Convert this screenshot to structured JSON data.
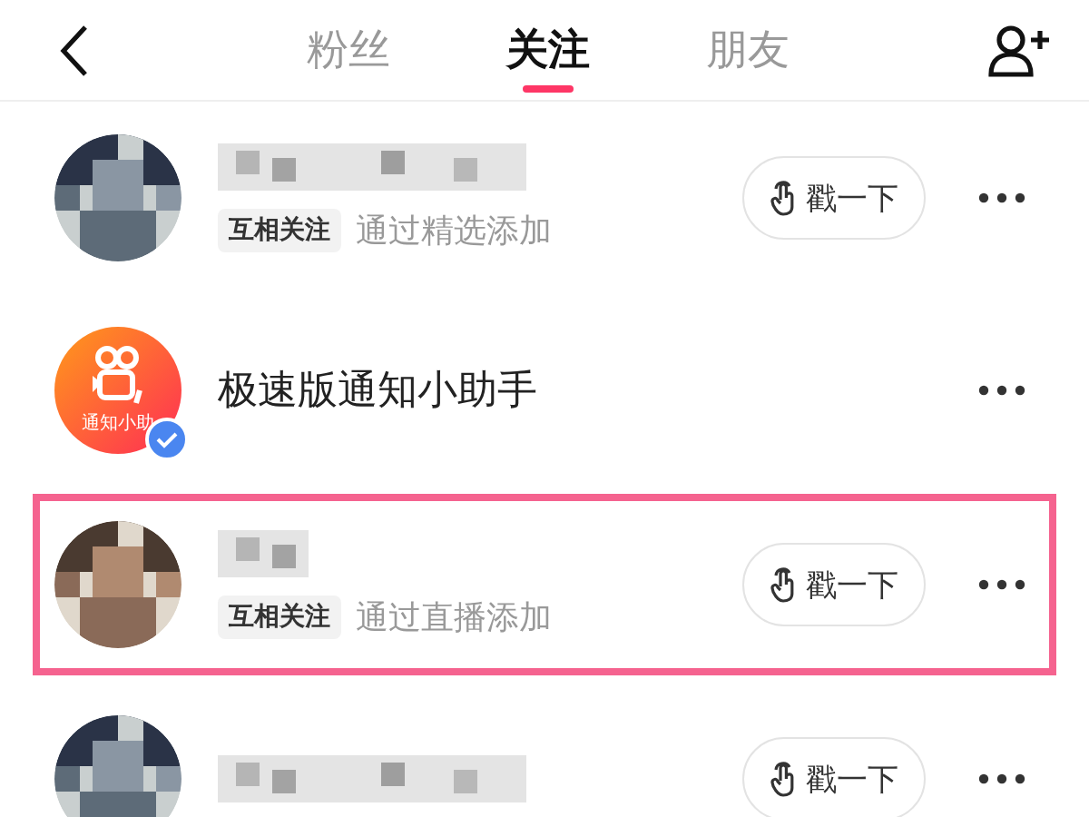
{
  "tabs": [
    {
      "label": "粉丝",
      "selected": false
    },
    {
      "label": "关注",
      "selected": true
    },
    {
      "label": "朋友",
      "selected": false
    }
  ],
  "rows": [
    {
      "kind": "person",
      "highlighted": false,
      "tag": "互相关注",
      "source": "通过精选添加",
      "action": "戳一下"
    },
    {
      "kind": "official",
      "highlighted": false,
      "name": "极速版通知小助手",
      "avatar_caption": "通知小助",
      "verified": true
    },
    {
      "kind": "person",
      "highlighted": true,
      "tag": "互相关注",
      "source": "通过直播添加",
      "action": "戳一下"
    },
    {
      "kind": "person",
      "highlighted": false,
      "action": "戳一下"
    }
  ]
}
